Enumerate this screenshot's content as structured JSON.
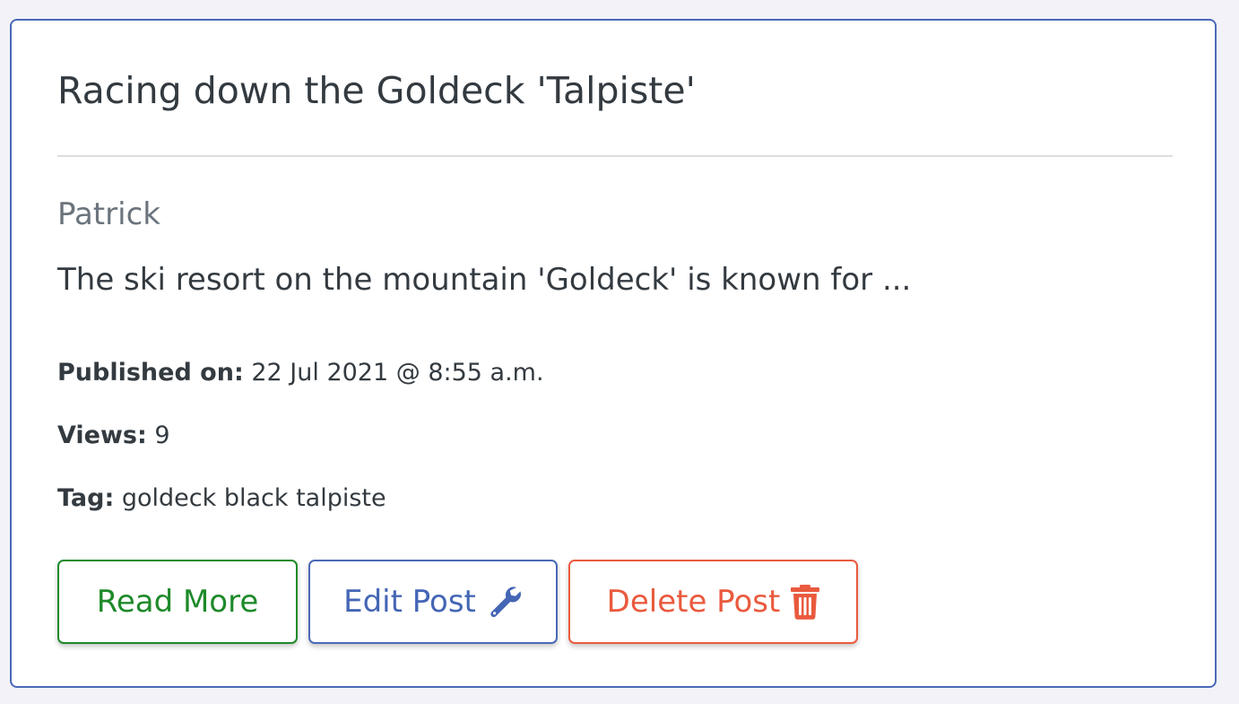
{
  "post": {
    "title": "Racing down the Goldeck 'Talpiste'",
    "author": "Patrick",
    "excerpt": "The ski resort on the mountain 'Goldeck' is known for ...",
    "published_label": "Published on:",
    "published_value": "22 Jul 2021 @ 8:55 a.m.",
    "views_label": "Views:",
    "views_value": "9",
    "tag_label": "Tag:",
    "tag_value": "goldeck black talpiste"
  },
  "actions": {
    "read_more_label": "Read More",
    "edit_label": "Edit Post",
    "edit_icon": "wrench-icon",
    "delete_label": "Delete Post",
    "delete_icon": "trash-icon"
  },
  "colors": {
    "card_border": "#4a69b8",
    "read_more": "#1e8a2a",
    "edit": "#4466b5",
    "delete": "#ea5a3e"
  }
}
